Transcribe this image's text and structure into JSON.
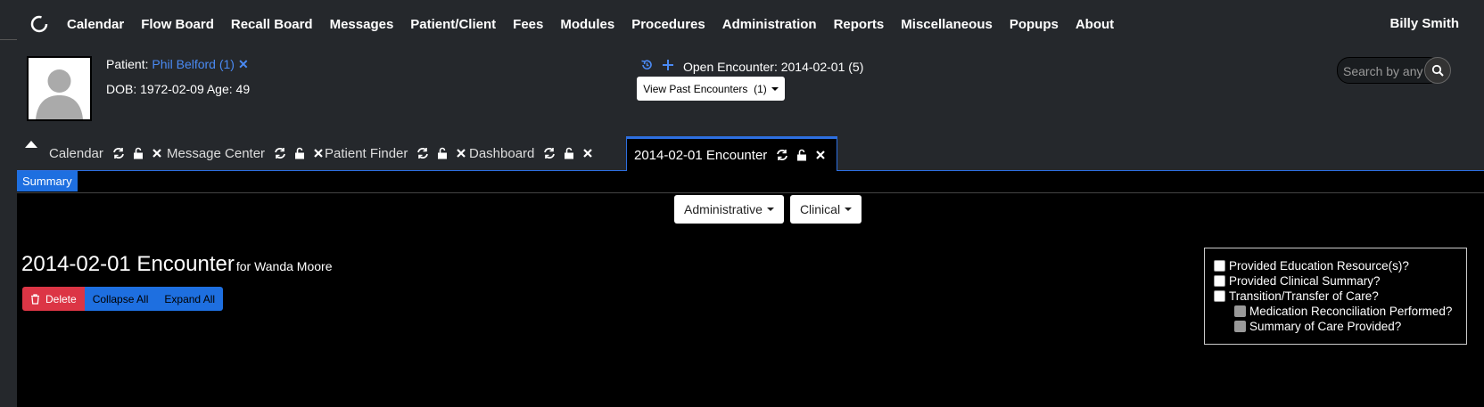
{
  "nav": {
    "items": [
      "Calendar",
      "Flow Board",
      "Recall Board",
      "Messages",
      "Patient/Client",
      "Fees",
      "Modules",
      "Procedures",
      "Administration",
      "Reports",
      "Miscellaneous",
      "Popups",
      "About"
    ],
    "user": "Billy Smith"
  },
  "patient": {
    "label": "Patient:",
    "name": "Phil Belford (1)",
    "dob_line": "DOB: 1972-02-09 Age: 49"
  },
  "encounter": {
    "open_label": "Open Encounter: 2014-02-01 (5)",
    "view_past_button": "View Past Encounters  (1)"
  },
  "search": {
    "placeholder": "Search by any de"
  },
  "tabs": [
    "Calendar",
    "Message Center",
    "Patient Finder",
    "Dashboard",
    "2014-02-01 Encounter"
  ],
  "active_tab": "2014-02-01 Encounter",
  "subtab": {
    "summary": "Summary"
  },
  "dropdowns": {
    "administrative": "Administrative",
    "clinical": "Clinical"
  },
  "page": {
    "title": "2014-02-01 Encounter",
    "for_label": "for Wanda Moore",
    "delete_button": "Delete",
    "collapse_all": "Collapse All",
    "expand_all": "Expand All"
  },
  "checklist": [
    {
      "label": "Provided Education Resource(s)?",
      "checked": false,
      "disabled": false
    },
    {
      "label": "Provided Clinical Summary?",
      "checked": false,
      "disabled": false
    },
    {
      "label": "Transition/Transfer of Care?",
      "checked": false,
      "disabled": false
    },
    {
      "label": "Medication Reconciliation Performed?",
      "checked": false,
      "disabled": true
    },
    {
      "label": "Summary of Care Provided?",
      "checked": false,
      "disabled": true
    }
  ],
  "colors": {
    "accent": "#2d6fe0",
    "danger": "#dc3545",
    "navbar": "#25282c",
    "link": "#4a8af4"
  }
}
